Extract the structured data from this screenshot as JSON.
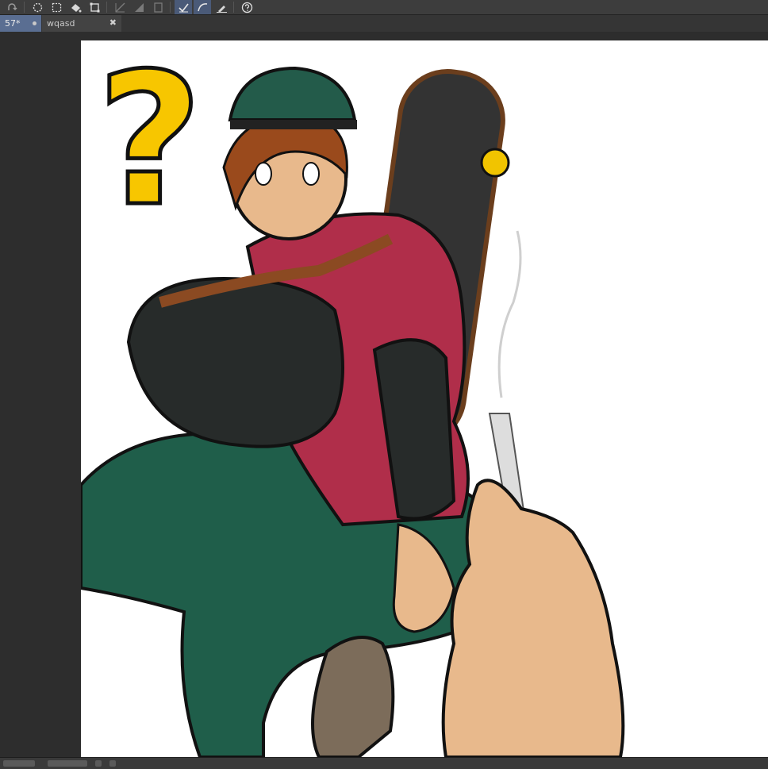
{
  "tabs": [
    {
      "label": "57*"
    },
    {
      "label": "wqasd"
    }
  ],
  "tab_close_glyph": "✖",
  "toolbar_icons": [
    "redo-icon",
    "lasso-select-icon",
    "marquee-select-icon",
    "paint-bucket-icon",
    "transform-icon",
    "diagonal-line-icon",
    "fill-triangle-icon",
    "rectangle-icon",
    "check-edit-icon",
    "curve-icon",
    "edit-pen-icon",
    "help-icon"
  ],
  "canvas_artwork": {
    "description_symbol": "?",
    "colors": {
      "canvas": "#ffffff",
      "question_mark": "#f7c600",
      "cap": "#235b4a",
      "hair": "#9a4a1c",
      "hoodie": "#b02e4a",
      "shirt": "#272b2a",
      "pants": "#1f5e4a",
      "skin": "#e8b98c",
      "skateboard": "#3a3a3a",
      "strap": "#8b4a22"
    }
  },
  "theme": {
    "toolbar_bg": "#3d3d3d",
    "tab_active_bg": "#5a6e92",
    "workspace_bg": "#2d2d2d"
  }
}
